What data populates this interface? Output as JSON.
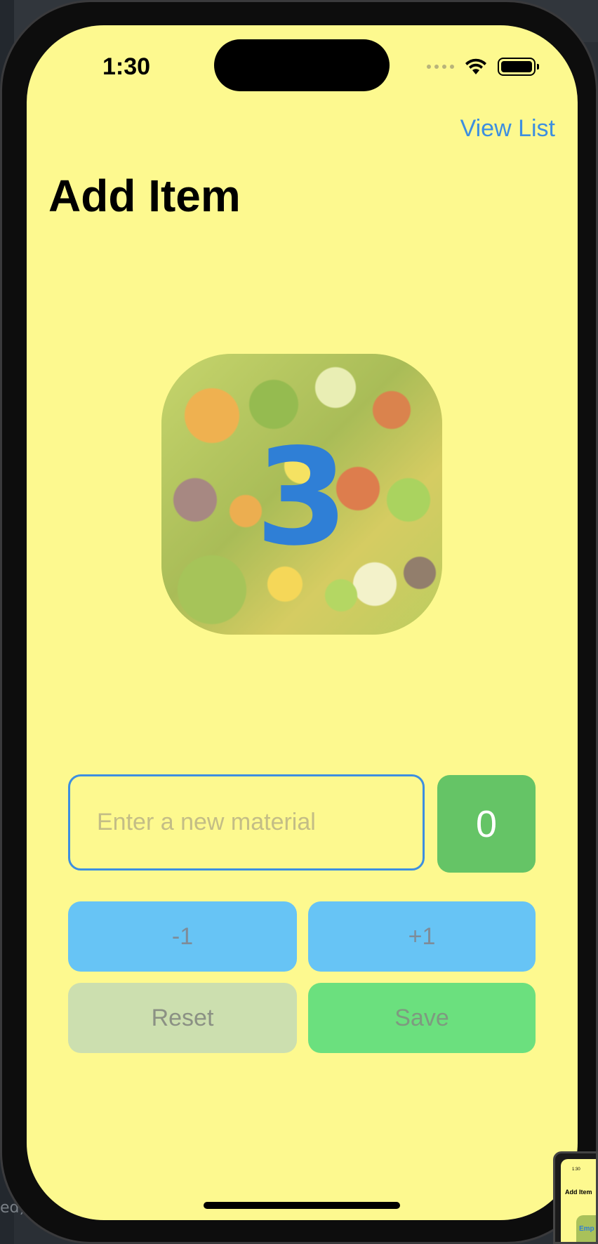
{
  "status_bar": {
    "time": "1:30"
  },
  "nav": {
    "view_list_label": "View List"
  },
  "page": {
    "title": "Add Item"
  },
  "image_card": {
    "count": "3",
    "icon": "vegetables-photo"
  },
  "form": {
    "material_placeholder": "Enter a new material",
    "material_value": "",
    "quantity": "0"
  },
  "buttons": {
    "decrement": "-1",
    "increment": "+1",
    "reset": "Reset",
    "save": "Save"
  },
  "thumbnail": {
    "time": "1:30",
    "title": "Add Item",
    "card_label": "Emp"
  },
  "desktop": {
    "left_label": "ed)"
  },
  "colors": {
    "background": "#fdf98f",
    "accent": "#3d8fe0",
    "count_badge": "#65c466",
    "step_buttons": "#67c4f5",
    "reset_button": "#ccdfaf",
    "save_button": "#6be07e"
  }
}
